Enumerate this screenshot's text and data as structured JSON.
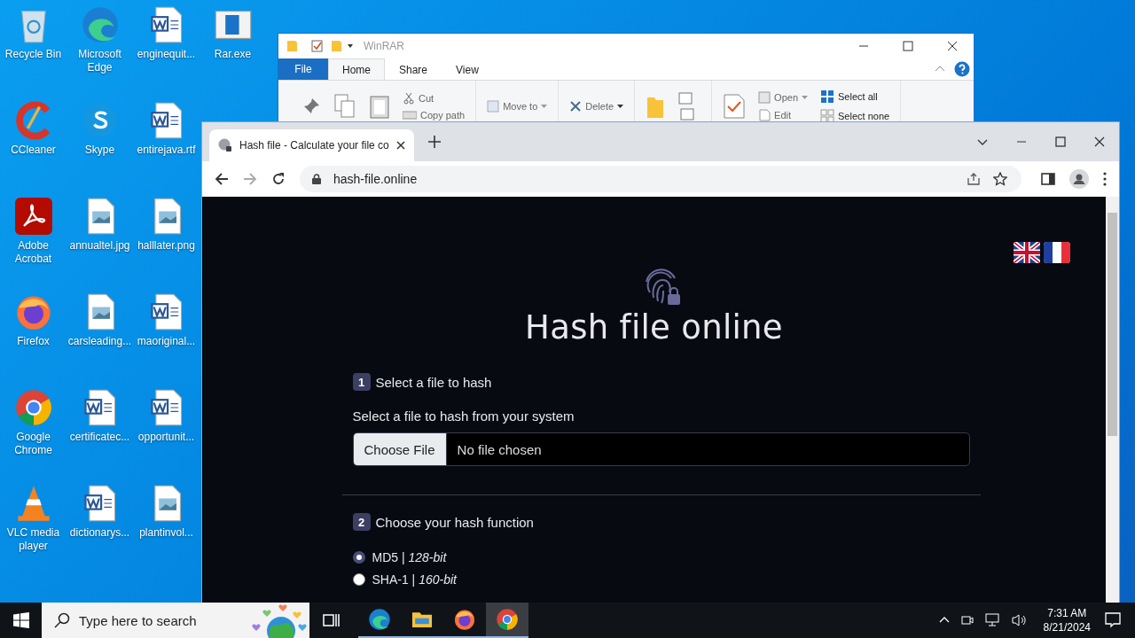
{
  "desktop": {
    "icons": [
      {
        "label": "Recycle Bin",
        "kind": "recycle"
      },
      {
        "label": "CCleaner",
        "kind": "ccleaner"
      },
      {
        "label": "Adobe Acrobat",
        "kind": "acrobat"
      },
      {
        "label": "Firefox",
        "kind": "firefox"
      },
      {
        "label": "Google Chrome",
        "kind": "chrome"
      },
      {
        "label": "VLC media player",
        "kind": "vlc"
      },
      {
        "label": "Microsoft Edge",
        "kind": "edge"
      },
      {
        "label": "Skype",
        "kind": "skype"
      },
      {
        "label": "annualtel.jpg",
        "kind": "image"
      },
      {
        "label": "carsleading...",
        "kind": "image"
      },
      {
        "label": "certificatec...",
        "kind": "word"
      },
      {
        "label": "dictionarys...",
        "kind": "word"
      },
      {
        "label": "enginequit...",
        "kind": "word"
      },
      {
        "label": "entirejava.rtf",
        "kind": "word"
      },
      {
        "label": "halllater.png",
        "kind": "image"
      },
      {
        "label": "maoriginal...",
        "kind": "word"
      },
      {
        "label": "opportunit...",
        "kind": "word"
      },
      {
        "label": "plantinvol...",
        "kind": "image"
      },
      {
        "label": "Rar.exe",
        "kind": "exe"
      }
    ]
  },
  "explorer": {
    "title": "WinRAR",
    "tabs": [
      {
        "label": "File",
        "kind": "file",
        "selected": false
      },
      {
        "label": "Home",
        "kind": "tab",
        "selected": true
      },
      {
        "label": "Share",
        "kind": "tab",
        "selected": false
      },
      {
        "label": "View",
        "kind": "tab",
        "selected": false
      }
    ],
    "ribbon": {
      "cut": "Cut",
      "copy_path": "Copy path",
      "move_to": "Move to",
      "delete": "Delete",
      "open": "Open",
      "edit": "Edit",
      "select_all": "Select all",
      "select_none": "Select none"
    }
  },
  "browser": {
    "tab_title": "Hash file - Calculate your file co",
    "url": "hash-file.online",
    "page": {
      "title": "Hash file online",
      "step1": {
        "number": "1",
        "heading": "Select a file to hash",
        "label": "Select a file to hash from your system",
        "button": "Choose File",
        "file_status": "No file chosen"
      },
      "step2": {
        "number": "2",
        "heading": "Choose your hash function",
        "options": [
          {
            "label": "MD5 | *128-bit*",
            "selected": true
          },
          {
            "label": "SHA-1 | *160-bit*",
            "selected": false
          }
        ]
      }
    }
  },
  "taskbar": {
    "search_placeholder": "Type here to search",
    "apps": [
      {
        "kind": "edge",
        "selected": false
      },
      {
        "kind": "explorer",
        "selected": false
      },
      {
        "kind": "firefox",
        "selected": false
      },
      {
        "kind": "chrome",
        "selected": true
      }
    ],
    "time": "7:31 AM",
    "date": "8/21/2024"
  }
}
